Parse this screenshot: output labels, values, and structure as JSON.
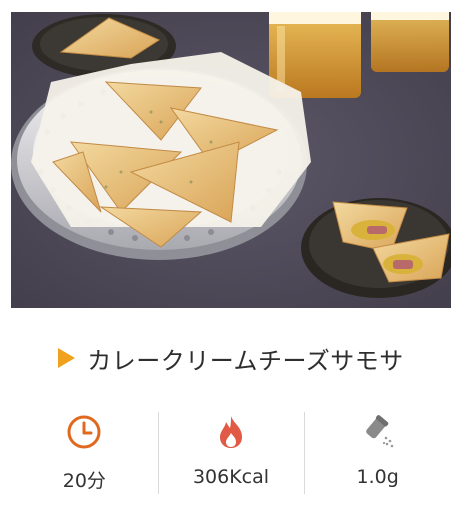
{
  "recipe": {
    "title": "カレークリームチーズサモサ",
    "accent_color": "#f0a21f",
    "photo": {
      "subject": "samosa-basket-photo"
    }
  },
  "stats": [
    {
      "icon": "clock-icon",
      "icon_color": "#e0691f",
      "value": "20分"
    },
    {
      "icon": "flame-icon",
      "icon_color": "#e05a45",
      "value": "306Kcal"
    },
    {
      "icon": "salt-shaker-icon",
      "icon_color": "#8a8a8a",
      "value": "1.0g"
    }
  ]
}
